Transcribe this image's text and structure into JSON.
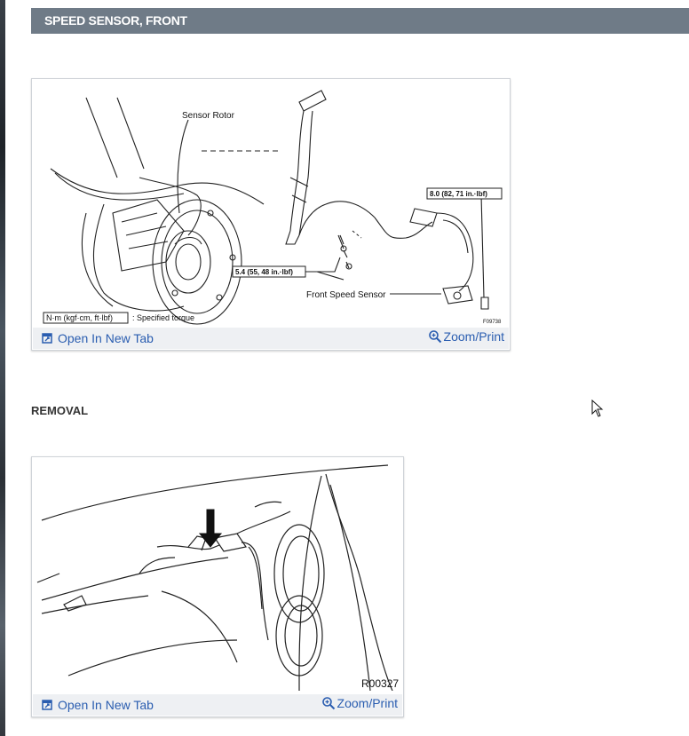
{
  "section": {
    "title": "SPEED SENSOR, FRONT"
  },
  "figure1": {
    "labels": {
      "sensor_rotor": "Sensor Rotor",
      "torque_large": "8.0 (82, 71 in.·lbf)",
      "torque_small": "5.4 (55, 48 in.·lbf)",
      "front_speed_sensor": "Front Speed Sensor",
      "unit_box": "N·m (kgf·cm, ft·lbf)",
      "specified_torque": ": Specified torque",
      "figure_code": "F09738"
    },
    "open_tab_label": "Open In New Tab",
    "zoom_label": "Zoom/Print"
  },
  "removal": {
    "heading": "REMOVAL"
  },
  "figure2": {
    "labels": {
      "figure_code": "R00327"
    },
    "open_tab_label": "Open In New Tab",
    "zoom_label": "Zoom/Print"
  },
  "colors": {
    "header_bg": "#6f7b87",
    "link": "#2a5db0",
    "toolbar_bg": "#eef0f3"
  },
  "icons": {
    "open_tab": "open-in-new-tab-icon",
    "zoom": "zoom-in-icon",
    "cursor": "mouse-pointer-icon"
  }
}
